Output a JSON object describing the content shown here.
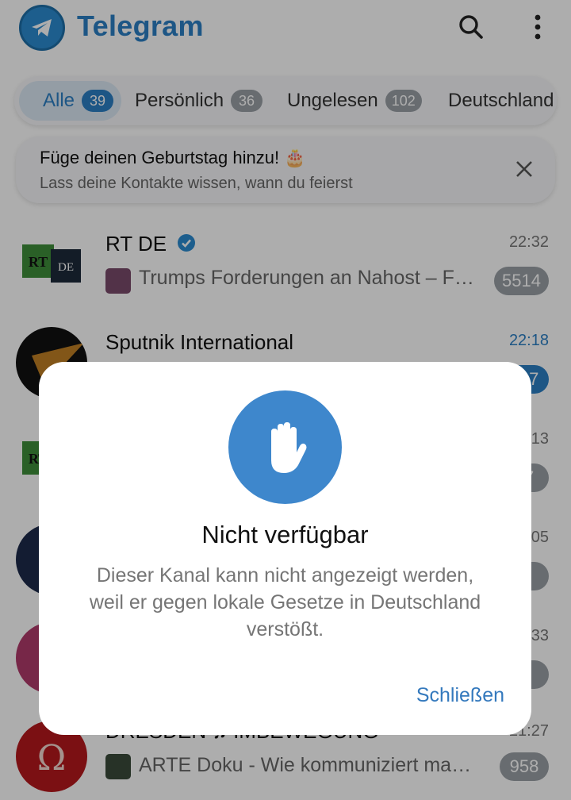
{
  "app": {
    "title": "Telegram"
  },
  "tabs": [
    {
      "label": "Alle",
      "count": "39"
    },
    {
      "label": "Persönlich",
      "count": "36"
    },
    {
      "label": "Ungelesen",
      "count": "102"
    },
    {
      "label": "Deutschland",
      "count": ""
    }
  ],
  "banner": {
    "title": "Füge deinen Geburtstag hinzu! 🎂",
    "subtitle": "Lass deine Kontakte wissen, wann du feierst"
  },
  "chats": [
    {
      "name": "RT DE",
      "verified": true,
      "time": "22:32",
      "preview": "Trumps Forderungen an Nahost – Frieden oder Krieg",
      "count": "5514",
      "avatar": "rt-de-logo"
    },
    {
      "name": "Sputnik International",
      "time": "22:18",
      "time_highlight": true,
      "preview": "",
      "count": "197",
      "count_highlight": true,
      "avatar": "sputnik-logo"
    },
    {
      "name": "",
      "time": "22:13",
      "preview": "",
      "count": "27",
      "avatar": "rt-logo"
    },
    {
      "name": "",
      "time": "22:05",
      "preview": "",
      "count": "5",
      "avatar": "round-logo-text"
    },
    {
      "name": "",
      "time": "21:33",
      "preview": "",
      "count": "1",
      "avatar": "pink-round-logo"
    },
    {
      "name": "DRESDEN ♫ IMBEWEGUNG",
      "time": "21:27",
      "preview": "ARTE Doku - Wie kommuniziert man mit Pflanzen",
      "count": "958",
      "avatar": "omega-logo"
    }
  ],
  "dialog": {
    "icon": "raised-hand-icon",
    "title": "Nicht verfügbar",
    "body": "Dieser Kanal kann nicht angezeigt werden, weil er gegen lokale Gesetze in Deutschland verstößt.",
    "button": "Schließen"
  },
  "colors": {
    "accent": "#2b7fc5",
    "dialog_icon_bg": "#3e87cc",
    "badge_muted": "#9aa0a6"
  }
}
